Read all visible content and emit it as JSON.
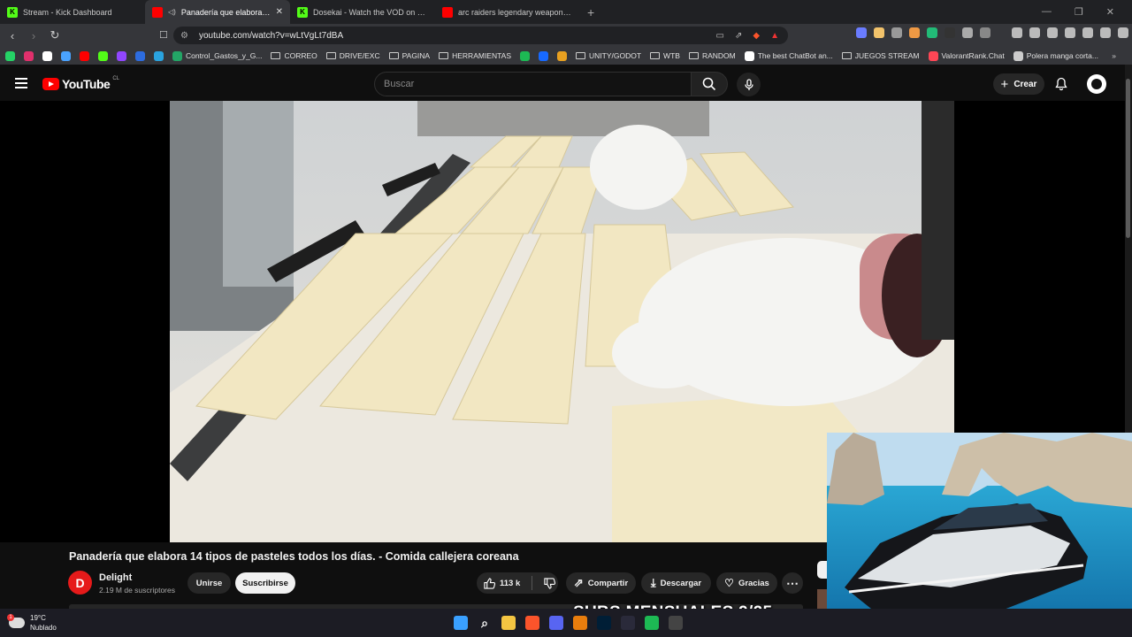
{
  "browser": {
    "tabs": [
      {
        "title": "Stream - Kick Dashboard",
        "favicon": "kick-icon",
        "color": "#53fc18",
        "active": false
      },
      {
        "title": "Panadería que elabora 14 tipos",
        "favicon": "youtube-icon",
        "color": "#ff0000",
        "active": true
      },
      {
        "title": "Dosekai - Watch the VOD on Kick",
        "favicon": "kick-icon",
        "color": "#53fc18",
        "active": false
      },
      {
        "title": "arc raiders legendary weapon - YouT",
        "favicon": "youtube-icon",
        "color": "#ff0000",
        "active": false
      }
    ],
    "url": "youtube.com/watch?v=wLtVgLt7dBA",
    "bookmarks": [
      {
        "label": "",
        "icon": "whatsapp-icon",
        "color": "#25d366"
      },
      {
        "label": "",
        "icon": "instagram-icon",
        "color": "#e1306c"
      },
      {
        "label": "",
        "icon": "x-icon",
        "color": "#ffffff"
      },
      {
        "label": "",
        "icon": "onedrive-icon",
        "color": "#4aa3ff"
      },
      {
        "label": "",
        "icon": "youtube-icon",
        "color": "#ff0000"
      },
      {
        "label": "",
        "icon": "kick-icon",
        "color": "#53fc18"
      },
      {
        "label": "",
        "icon": "twitch-icon",
        "color": "#9146ff"
      },
      {
        "label": "",
        "icon": "paypal-icon",
        "color": "#2d6cdf"
      },
      {
        "label": "",
        "icon": "telegram-icon",
        "color": "#2aa3df"
      },
      {
        "label": "Control_Gastos_y_G...",
        "icon": "sheets-icon",
        "color": "#23a566"
      },
      {
        "label": "CORREO",
        "icon": "folder-icon",
        "color": ""
      },
      {
        "label": "DRIVE/EXC",
        "icon": "folder-icon",
        "color": ""
      },
      {
        "label": "PAGINA",
        "icon": "folder-icon",
        "color": ""
      },
      {
        "label": "HERRAMIENTAS",
        "icon": "folder-icon",
        "color": ""
      },
      {
        "label": "",
        "icon": "app-icon",
        "color": "#1db954"
      },
      {
        "label": "",
        "icon": "behance-icon",
        "color": "#1769ff"
      },
      {
        "label": "",
        "icon": "app-icon",
        "color": "#e8a020"
      },
      {
        "label": "UNITY/GODOT",
        "icon": "folder-icon",
        "color": ""
      },
      {
        "label": "WTB",
        "icon": "folder-icon",
        "color": ""
      },
      {
        "label": "RANDOM",
        "icon": "folder-icon",
        "color": ""
      },
      {
        "label": "The best ChatBot an...",
        "icon": "diamond-icon",
        "color": "#ffffff"
      },
      {
        "label": "JUEGOS STREAM",
        "icon": "folder-icon",
        "color": ""
      },
      {
        "label": "ValorantRank.Chat",
        "icon": "valorant-icon",
        "color": "#ff4655"
      },
      {
        "label": "Polera manga corta...",
        "icon": "globe-icon",
        "color": "#cccccc"
      }
    ]
  },
  "youtube": {
    "logo_text": "YouTube",
    "region": "CL",
    "search_placeholder": "Buscar",
    "create_label": "Crear"
  },
  "video": {
    "title": "Panadería que elabora 14 tipos de pasteles todos los días. - Comida callejera coreana",
    "channel": {
      "name": "Delight",
      "subscribers": "2.19 M de suscriptores",
      "avatar_letter": "D",
      "avatar_color": "#e61a1a"
    },
    "buttons": {
      "join": "Unirse",
      "subscribe": "Suscribirse",
      "likes": "113 k",
      "share": "Compartir",
      "download": "Descargar",
      "thanks": "Gracias"
    }
  },
  "overlay": {
    "subs_text": "SUBS MENSUALES 9/25"
  },
  "taskbar": {
    "weather_temp": "19°C",
    "weather_desc": "Nublado",
    "apps": [
      {
        "icon": "windows-start-icon",
        "color": "#3aa0ff"
      },
      {
        "icon": "search-icon",
        "color": "#1c1c24"
      },
      {
        "icon": "file-explorer-icon",
        "color": "#f4c542"
      },
      {
        "icon": "brave-browser-icon",
        "color": "#fb542b"
      },
      {
        "icon": "discord-icon",
        "color": "#5865f2"
      },
      {
        "icon": "blender-icon",
        "color": "#e87d0d"
      },
      {
        "icon": "photoshop-icon",
        "color": "#001e36"
      },
      {
        "icon": "app-icon",
        "color": "#2a2a3a"
      },
      {
        "icon": "spotify-icon",
        "color": "#1db954"
      },
      {
        "icon": "app-icon",
        "color": "#444"
      }
    ]
  }
}
